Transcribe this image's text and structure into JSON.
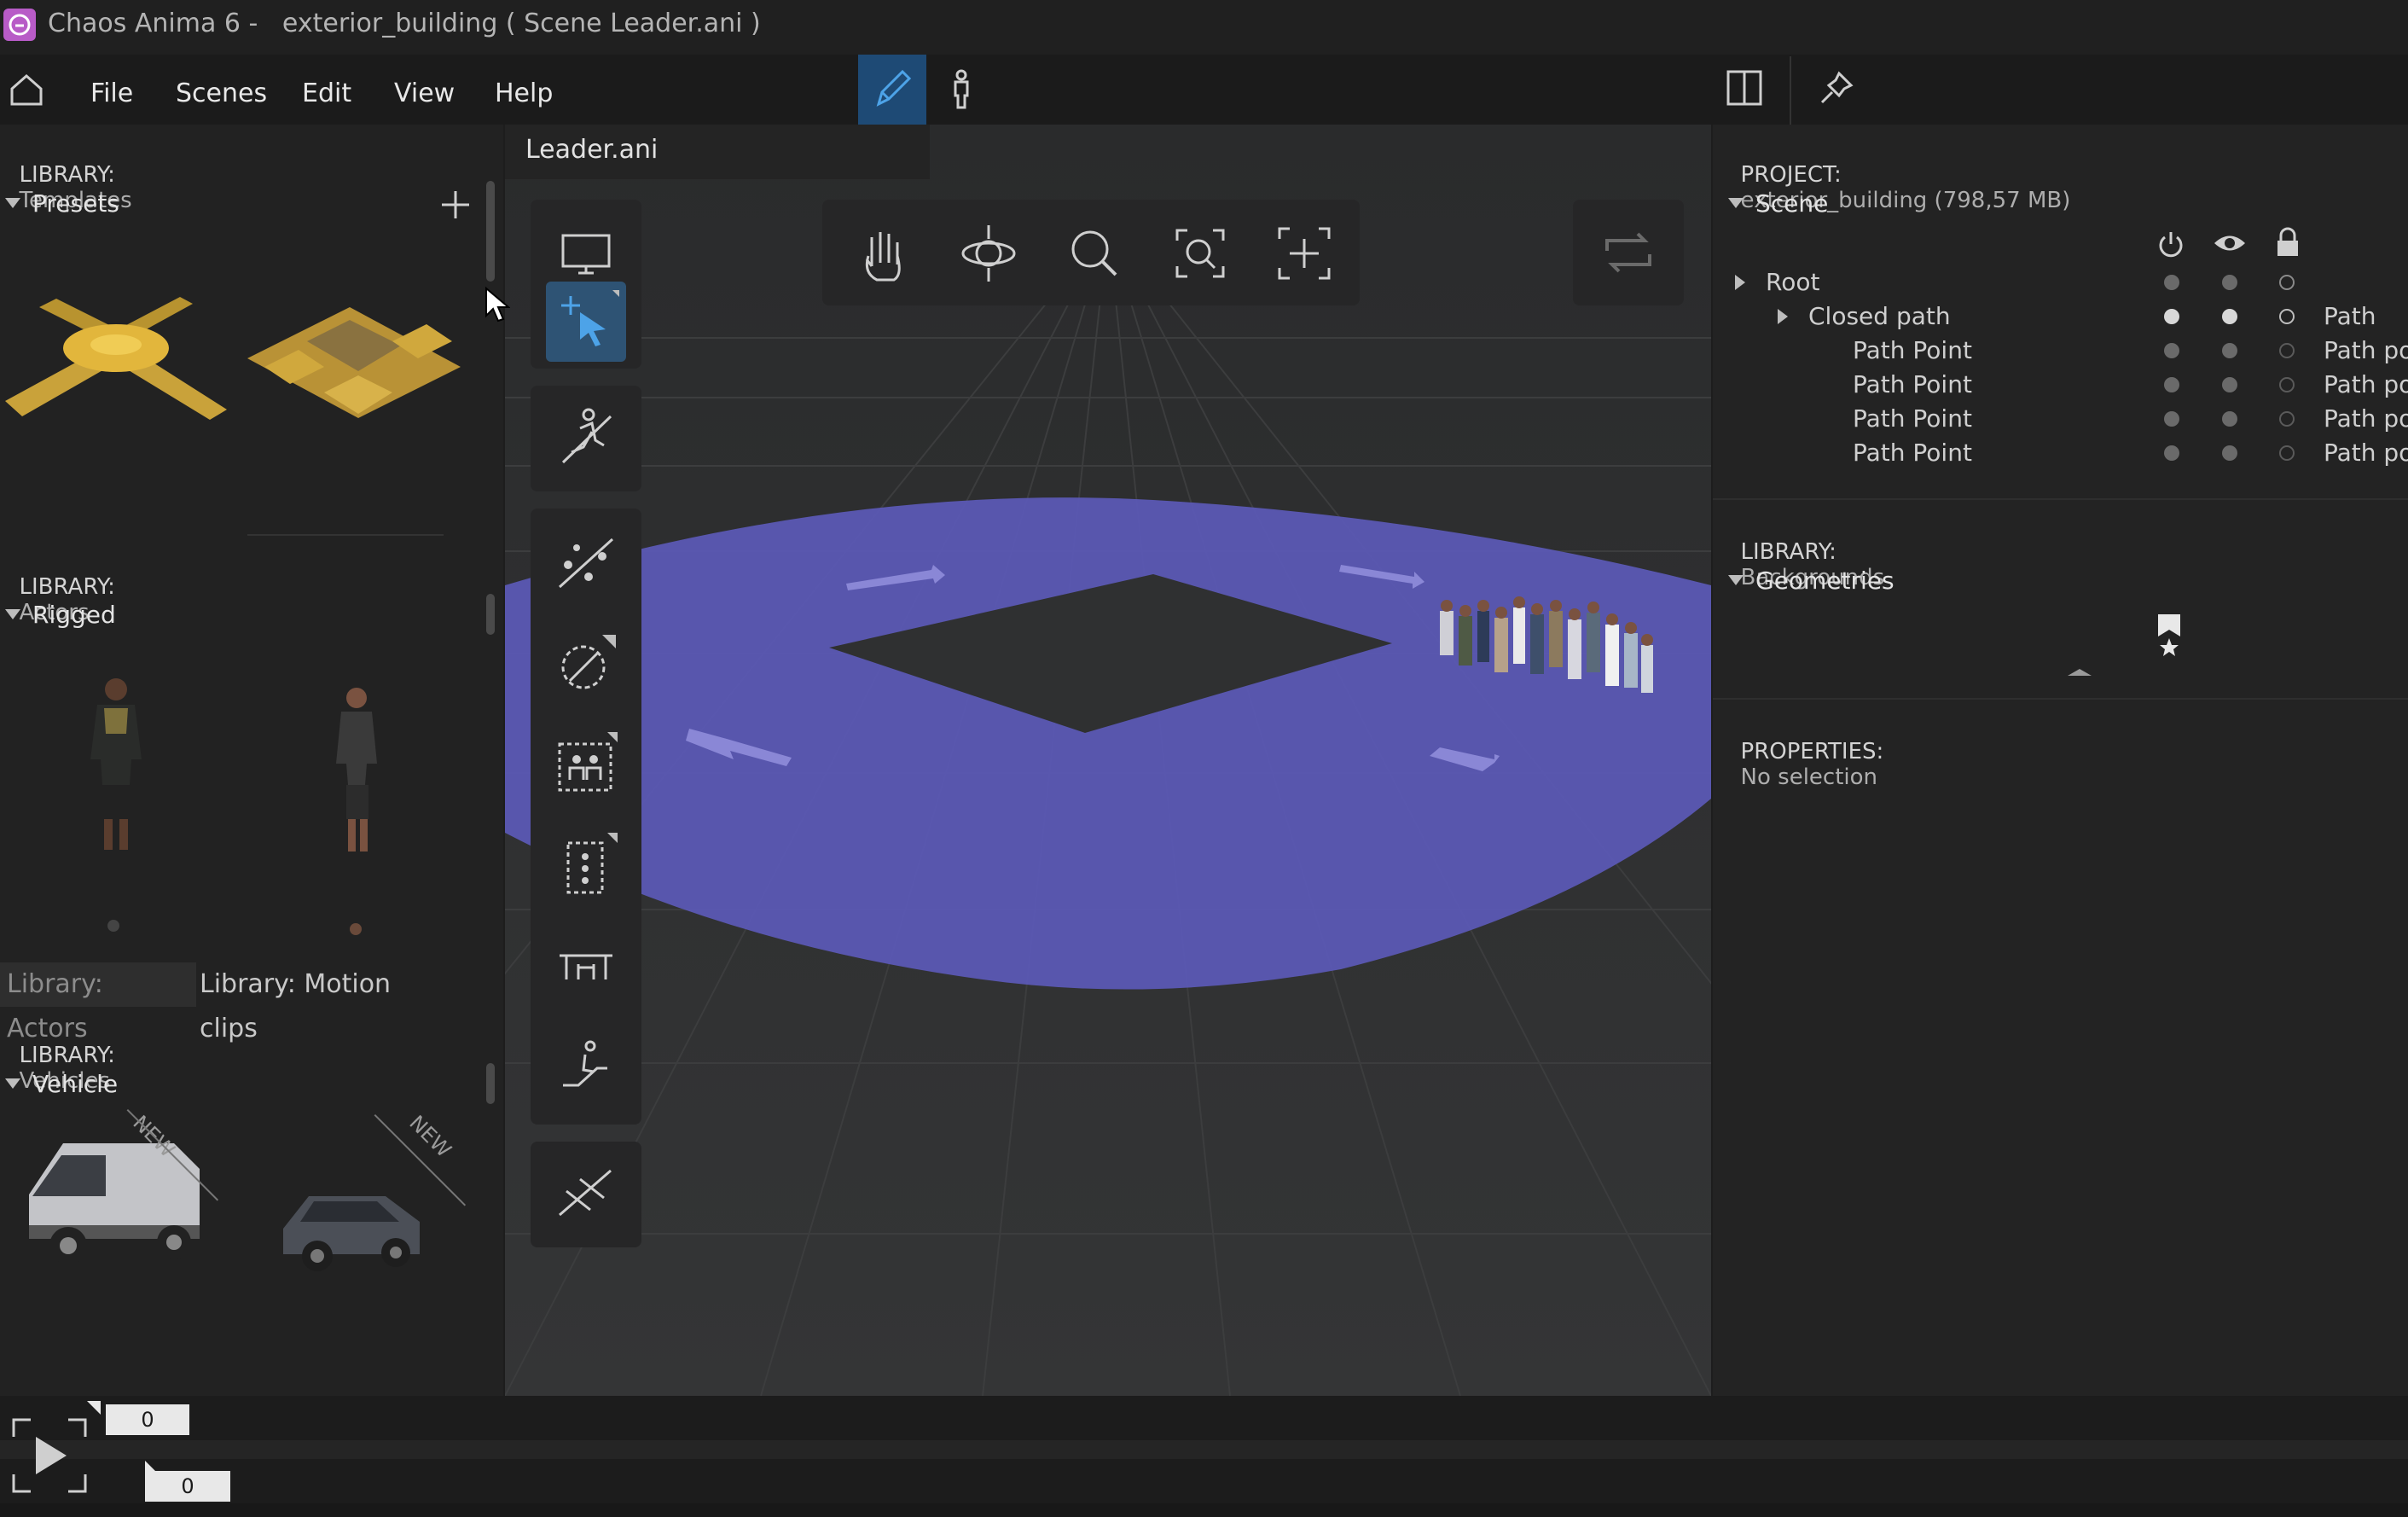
{
  "app": {
    "title": "Chaos Anima 6 -   exterior_building ( Scene Leader.ani )"
  },
  "menu": {
    "items": [
      "File",
      "Scenes",
      "Edit",
      "View",
      "Help"
    ]
  },
  "left_panel": {
    "templates": {
      "prefix": "LIBRARY:",
      "name": "Templates",
      "section": "Presets"
    },
    "actors": {
      "prefix": "LIBRARY:",
      "name": "Actors",
      "section": "Rigged"
    },
    "tabs": [
      "Library: Actors",
      "Library: Motion clips"
    ],
    "vehicles": {
      "prefix": "LIBRARY:",
      "name": "Vehicles",
      "section": "Vehicle",
      "badge": "NEW"
    }
  },
  "viewport": {
    "doc_tab": "Leader.ani"
  },
  "right_panel": {
    "project": {
      "prefix": "PROJECT:",
      "name": "exterior_building (798,57 MB)"
    },
    "scene": {
      "section": "Scene",
      "rows": [
        {
          "label": "Root",
          "type": ""
        },
        {
          "label": "Closed path",
          "type": "Path"
        },
        {
          "label": "Path Point",
          "type": "Path po"
        },
        {
          "label": "Path Point",
          "type": "Path po"
        },
        {
          "label": "Path Point",
          "type": "Path po"
        },
        {
          "label": "Path Point",
          "type": "Path po"
        }
      ]
    },
    "backgrounds": {
      "prefix": "LIBRARY:",
      "name": "Backgrounds",
      "section": "Geometries"
    },
    "properties": {
      "prefix": "PROPERTIES:",
      "value": "No selection"
    }
  },
  "timeline": {
    "top_frame": "0",
    "bottom_frame": "0"
  },
  "colors": {
    "accent": "#4da3e8",
    "path_floor": "#5b58b4",
    "template_gold": "#c9a23a"
  }
}
